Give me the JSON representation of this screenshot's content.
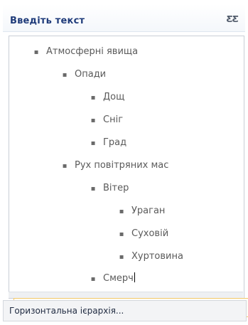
{
  "pane": {
    "title": "Введіть текст",
    "close_label": "ƸƸ"
  },
  "outline": [
    {
      "text": "Атмосферні явища",
      "level": 1
    },
    {
      "text": "Опади",
      "level": 2
    },
    {
      "text": "Дощ",
      "level": 3
    },
    {
      "text": "Сніг",
      "level": 3
    },
    {
      "text": "Град",
      "level": 3
    },
    {
      "text": "Рух повітряних мас",
      "level": 2
    },
    {
      "text": "Вітер",
      "level": 3
    },
    {
      "text": "Ураган",
      "level": 4
    },
    {
      "text": "Суховій",
      "level": 4
    },
    {
      "text": "Хуртовина",
      "level": 4
    },
    {
      "text": "Смерч",
      "level": 3
    }
  ],
  "bullet_char": "▪",
  "footer": {
    "link_label": "Горизонтальна ієрархія..."
  }
}
